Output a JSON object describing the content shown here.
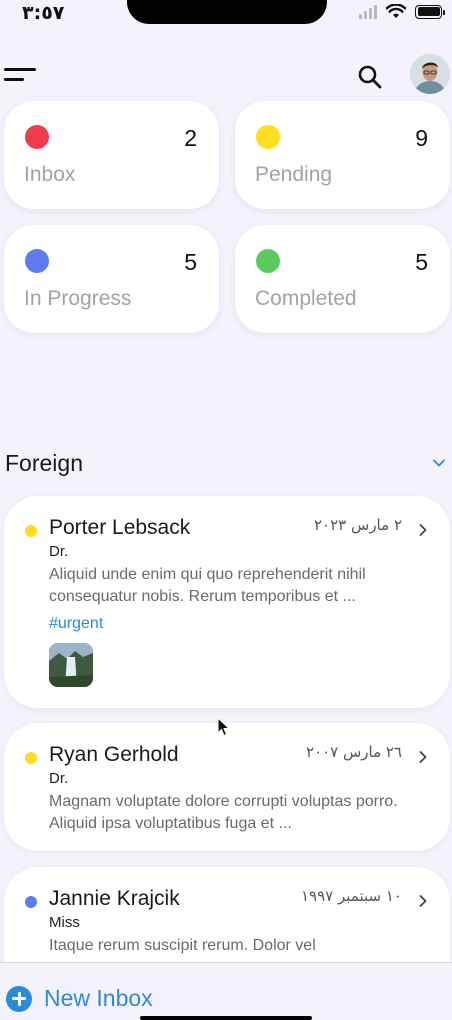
{
  "status_bar": {
    "time": "٣:٥٧",
    "icons": [
      "signal-icon",
      "wifi-icon",
      "battery-icon"
    ]
  },
  "header": {
    "icons": [
      "menu-icon",
      "search-icon",
      "avatar"
    ]
  },
  "status_cards": [
    {
      "label": "Inbox",
      "count": "2",
      "color": "#EE3B4E"
    },
    {
      "label": "Pending",
      "count": "9",
      "color": "#FFDD1F"
    },
    {
      "label": "In Progress",
      "count": "5",
      "color": "#5C7BF0"
    },
    {
      "label": "Completed",
      "count": "5",
      "color": "#5CC95E"
    }
  ],
  "section": {
    "title": "Foreign",
    "icon": "chevron-down-icon"
  },
  "mails": [
    {
      "sender": "Porter Lebsack",
      "title": "Dr.",
      "date": "٢ مارس ٢٠٢٣",
      "body": "Aliquid unde enim qui quo reprehenderit nihil consequatur nobis. Rerum temporibus et ...",
      "tag": "#urgent",
      "dot_color": "#FFDD1F",
      "has_thumbnail": true
    },
    {
      "sender": "Ryan Gerhold",
      "title": "Dr.",
      "date": "٢٦ مارس ٢٠٠٧",
      "body": "Magnam voluptate dolore corrupti voluptas porro. Aliquid ipsa voluptatibus fuga et ...",
      "dot_color": "#FFDD1F"
    },
    {
      "sender": "Jannie Krajcik",
      "title": "Miss",
      "date": "١٠ سبتمبر ١٩٩٧",
      "body": "Itaque rerum suscipit rerum. Dolor vel",
      "dot_color": "#5C7BF0"
    }
  ],
  "bottom_bar": {
    "new_inbox_label": "New Inbox",
    "icon": "plus-circle-icon"
  },
  "colors": {
    "background": "#F4F2FB",
    "accent": "#2B8BD6",
    "card": "#FFFFFF"
  }
}
